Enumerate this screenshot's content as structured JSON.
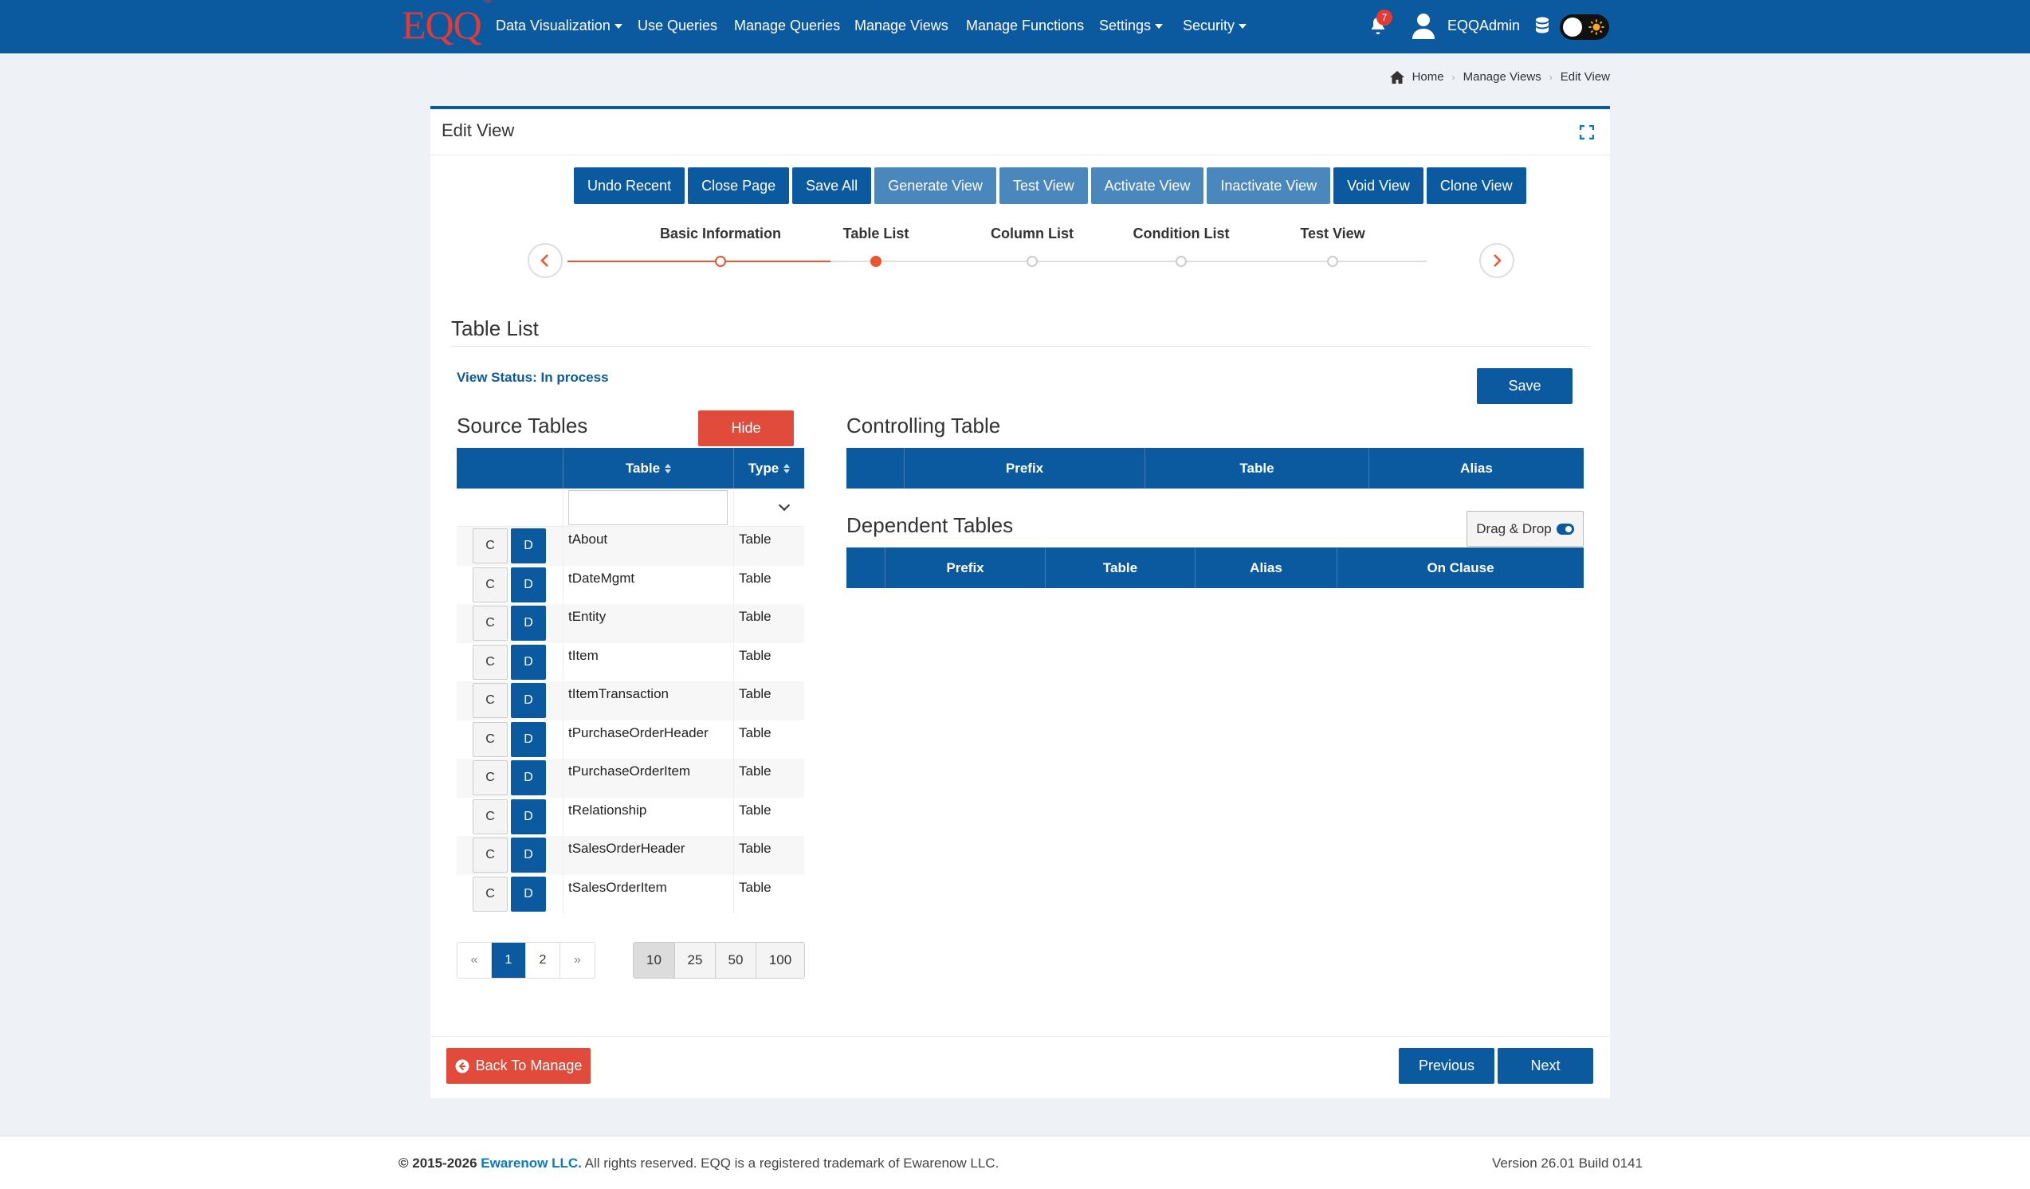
{
  "navbar": {
    "logo": "EQQ",
    "logo_mark": "®",
    "items": [
      {
        "label": "Data Visualization",
        "dropdown": true
      },
      {
        "label": "Use Queries",
        "dropdown": false
      },
      {
        "label": "Manage Queries",
        "dropdown": false
      },
      {
        "label": "Manage Views",
        "dropdown": false
      },
      {
        "label": "Manage Functions",
        "dropdown": false
      },
      {
        "label": "Settings",
        "dropdown": true
      },
      {
        "label": "Security",
        "dropdown": true
      }
    ],
    "notification_count": "7",
    "user_name": "EQQAdmin"
  },
  "breadcrumb": [
    "Home",
    "Manage Views",
    "Edit View"
  ],
  "card": {
    "title": "Edit View",
    "toolbar": [
      {
        "label": "Undo Recent",
        "style": "dark"
      },
      {
        "label": "Close Page",
        "style": "dark"
      },
      {
        "label": "Save All",
        "style": "dark"
      },
      {
        "label": "Generate View",
        "style": "light"
      },
      {
        "label": "Test View",
        "style": "light"
      },
      {
        "label": "Activate View",
        "style": "light"
      },
      {
        "label": "Inactivate View",
        "style": "light"
      },
      {
        "label": "Void View",
        "style": "dark"
      },
      {
        "label": "Clone View",
        "style": "dark"
      }
    ],
    "steps": [
      {
        "label": "Basic Information",
        "state": "done"
      },
      {
        "label": "Table List",
        "state": "active"
      },
      {
        "label": "Column List",
        "state": "todo"
      },
      {
        "label": "Condition List",
        "state": "todo"
      },
      {
        "label": "Test View",
        "state": "todo"
      }
    ],
    "section_title": "Table List",
    "view_status": "View Status: In process",
    "save_label": "Save"
  },
  "source_tables": {
    "title": "Source Tables",
    "hide_label": "Hide",
    "headers": [
      "",
      "Table",
      "Type"
    ],
    "c_label": "C",
    "d_label": "D",
    "rows": [
      {
        "table": "tAbout",
        "type": "Table"
      },
      {
        "table": "tDateMgmt",
        "type": "Table"
      },
      {
        "table": "tEntity",
        "type": "Table"
      },
      {
        "table": "tItem",
        "type": "Table"
      },
      {
        "table": "tItemTransaction",
        "type": "Table"
      },
      {
        "table": "tPurchaseOrderHeader",
        "type": "Table"
      },
      {
        "table": "tPurchaseOrderItem",
        "type": "Table"
      },
      {
        "table": "tRelationship",
        "type": "Table"
      },
      {
        "table": "tSalesOrderHeader",
        "type": "Table"
      },
      {
        "table": "tSalesOrderItem",
        "type": "Table"
      }
    ],
    "pager": [
      "«",
      "1",
      "2",
      "»"
    ],
    "active_page": "1",
    "page_sizes": [
      "10",
      "25",
      "50",
      "100"
    ],
    "active_size": "10"
  },
  "controlling_table": {
    "title": "Controlling Table",
    "headers": [
      "",
      "Prefix",
      "Table",
      "Alias"
    ]
  },
  "dependent_tables": {
    "title": "Dependent Tables",
    "drag_drop_label": "Drag & Drop",
    "headers": [
      "",
      "Prefix",
      "Table",
      "Alias",
      "On Clause"
    ]
  },
  "footer_buttons": {
    "back": "Back To Manage",
    "previous": "Previous",
    "next": "Next"
  },
  "page_footer": {
    "copyright_years": "© 2015-2026",
    "company": "Ewarenow LLC.",
    "rest": " All rights reserved. EQQ is a registered trademark of Ewarenow LLC.",
    "version": "Version 26.01 Build 0141"
  },
  "colors": {
    "primary": "#0b5aa0",
    "primary_light": "#4a87bd",
    "danger": "#e14b3b",
    "stepper_accent": "#e8572e"
  }
}
